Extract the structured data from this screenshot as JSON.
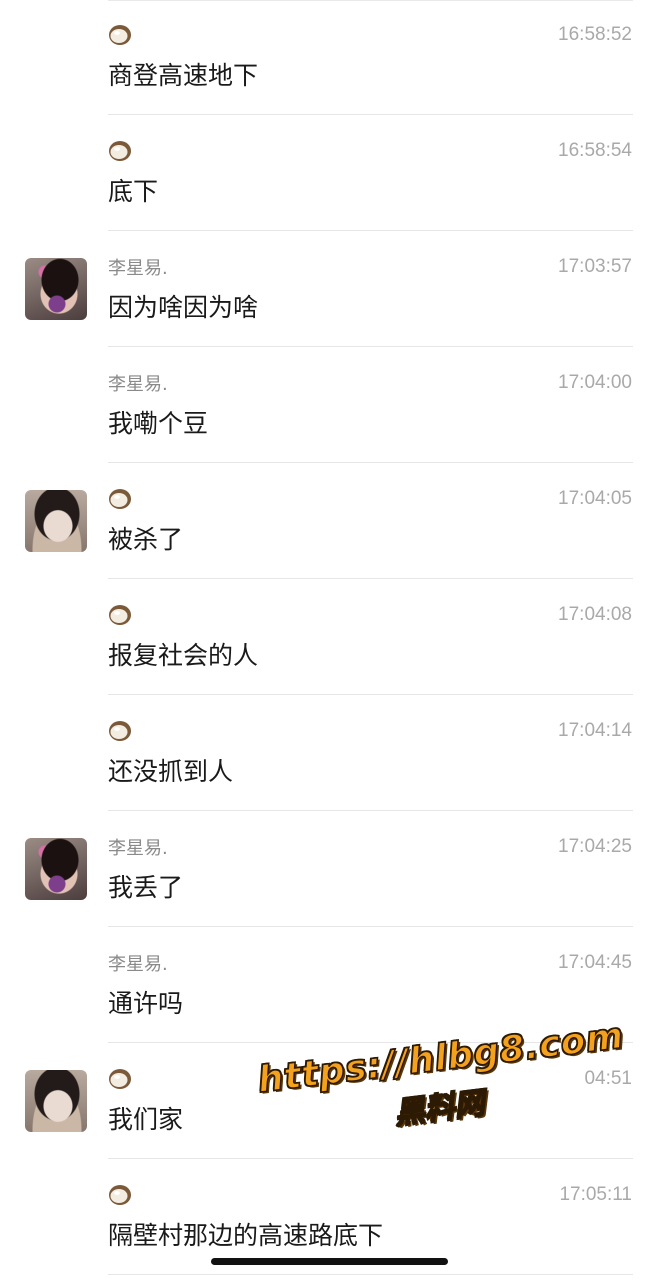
{
  "messages": [
    {
      "sender": "coconut-icon",
      "name": "",
      "time": "16:58:52",
      "text": "商登高速地下",
      "avatar": ""
    },
    {
      "sender": "coconut-icon",
      "name": "",
      "time": "16:58:54",
      "text": "底下",
      "avatar": ""
    },
    {
      "sender": "name",
      "name": "李星易.",
      "time": "17:03:57",
      "text": "因为啥因为啥",
      "avatar": "avatar-flower-girl"
    },
    {
      "sender": "name",
      "name": "李星易.",
      "time": "17:04:00",
      "text": "我嘞个豆",
      "avatar": ""
    },
    {
      "sender": "coconut-icon",
      "name": "",
      "time": "17:04:05",
      "text": "被杀了",
      "avatar": "avatar-girl"
    },
    {
      "sender": "coconut-icon",
      "name": "",
      "time": "17:04:08",
      "text": "报复社会的人",
      "avatar": ""
    },
    {
      "sender": "coconut-icon",
      "name": "",
      "time": "17:04:14",
      "text": "还没抓到人",
      "avatar": ""
    },
    {
      "sender": "name",
      "name": "李星易.",
      "time": "17:04:25",
      "text": "我丢了",
      "avatar": "avatar-flower-girl"
    },
    {
      "sender": "name",
      "name": "李星易.",
      "time": "17:04:45",
      "text": "通许吗",
      "avatar": ""
    },
    {
      "sender": "coconut-icon",
      "name": "",
      "time": "04:51",
      "text": "我们家",
      "avatar": "avatar-girl"
    },
    {
      "sender": "coconut-icon",
      "name": "",
      "time": "17:05:11",
      "text": "隔壁村那边的高速路底下",
      "avatar": ""
    }
  ],
  "watermark": {
    "url": "https://hlbg8.com",
    "label": "黑料网"
  },
  "colors": {
    "accent_watermark": "#f4a21d",
    "time_text": "#a9a9a9",
    "name_text": "#8a8a8a"
  }
}
